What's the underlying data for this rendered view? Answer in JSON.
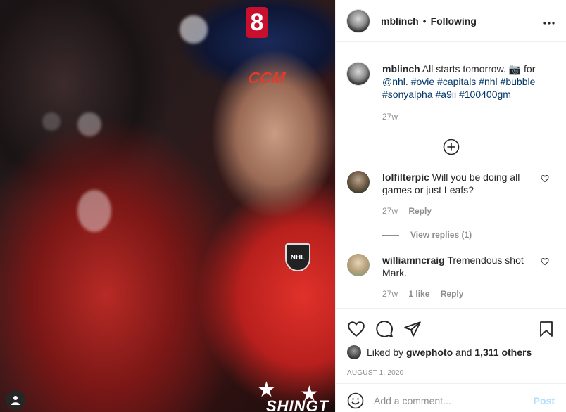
{
  "photo": {
    "helmet_number": "8",
    "helmet_brand": "CCM",
    "jersey_logo": "NHL",
    "jersey_text": "SHINGT"
  },
  "header": {
    "username": "mblinch",
    "separator": "•",
    "follow_status": "Following",
    "more_icon": "more-horizontal-icon"
  },
  "caption": {
    "username": "mblinch",
    "text_pre": "All starts tomorrow. 📷 for",
    "mention": "@nhl.",
    "hashtags": "#ovie #capitals #nhl #bubble #sonyalpha #a9ii #100400gm",
    "time": "27w"
  },
  "load_more_icon": "plus-circle-icon",
  "comments": [
    {
      "username": "lolfilterpic",
      "text": "Will you be doing all games or just Leafs?",
      "time": "27w",
      "likes": "",
      "reply_label": "Reply",
      "view_replies": "View replies (1)"
    },
    {
      "username": "williamncraig",
      "text": "Tremendous shot Mark.",
      "time": "27w",
      "likes": "1 like",
      "reply_label": "Reply"
    }
  ],
  "actions": {
    "like_icon": "heart-icon",
    "comment_icon": "comment-icon",
    "share_icon": "share-icon",
    "save_icon": "bookmark-icon"
  },
  "likes": {
    "prefix": "Liked by",
    "user": "gwephoto",
    "conj": "and",
    "count": "1,311 others"
  },
  "date": "AUGUST 1, 2020",
  "add_comment": {
    "placeholder": "Add a comment...",
    "post_label": "Post"
  },
  "colors": {
    "link": "#00376b",
    "muted": "#8e8e8e",
    "post_disabled": "#b2dffc",
    "jersey_red": "#c8102e"
  }
}
